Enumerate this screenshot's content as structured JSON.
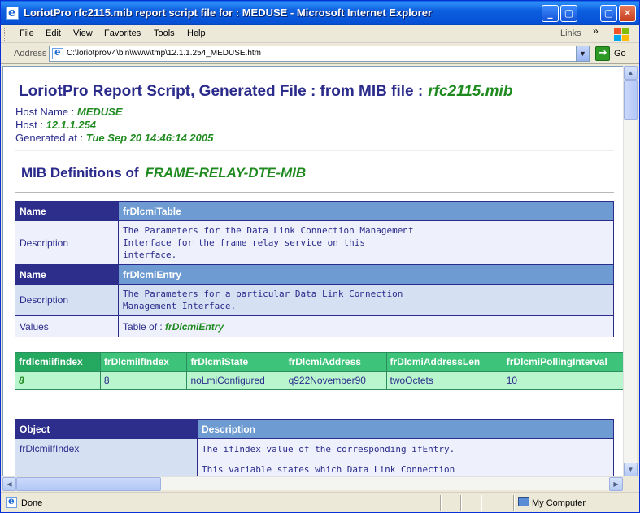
{
  "window": {
    "title": "LoriotPro rfc2115.mib report script file for : MEDUSE - Microsoft Internet Explorer",
    "minimize": "_",
    "maximize": "▢",
    "close": "✕"
  },
  "menu": {
    "items": [
      "File",
      "Edit",
      "View",
      "Favorites",
      "Tools",
      "Help"
    ],
    "links_label": "Links",
    "chevron": "»"
  },
  "address": {
    "label": "Address",
    "url": "C:\\loriotproV4\\bin\\www\\tmp\\12.1.1.254_MEDUSE.htm",
    "dropdown": "▼",
    "go_arrow": "→",
    "go_label": "Go"
  },
  "report": {
    "title_prefix": "LoriotPro Report Script, Generated File : from MIB file :",
    "mib_file": "rfc2115.mib",
    "host_name_label": "Host Name :",
    "host_name": "MEDUSE",
    "host_label": "Host :",
    "host": "12.1.1.254",
    "generated_label": "Generated at :",
    "generated": "Tue Sep 20 14:46:14 2005",
    "defs_prefix": "MIB Definitions of",
    "mib_module": "FRAME-RELAY-DTE-MIB"
  },
  "definitions": {
    "name_label": "Name",
    "description_label": "Description",
    "values_label": "Values",
    "table_name": "frDlcmiTable",
    "table_desc": [
      "The Parameters for the Data Link Connection Management",
      "Interface for the frame relay service on this",
      "interface."
    ],
    "entry_name": "frDlcmiEntry",
    "entry_desc": [
      "The Parameters for a particular Data Link Connection",
      "Management Interface."
    ],
    "values_prefix": "Table of :",
    "values_ref": "frDlcmiEntry"
  },
  "index_table": {
    "headers": [
      "frdlcmiifindex",
      "frDlcmiIfIndex",
      "frDlcmiState",
      "frDlcmiAddress",
      "frDlcmiAddressLen",
      "frDlcmiPollingInterval"
    ],
    "row": [
      "8",
      "8",
      "noLmiConfigured",
      "q922November90",
      "twoOctets",
      "10"
    ]
  },
  "object_table": {
    "headers": [
      "Object",
      "Description"
    ],
    "rows": [
      {
        "object": "frDlcmiIfIndex",
        "description": "The ifIndex value of the corresponding ifEntry."
      },
      {
        "object": "",
        "description": "This variable states which Data Link Connection"
      }
    ]
  },
  "status": {
    "text": "Done",
    "zone": "My Computer"
  }
}
